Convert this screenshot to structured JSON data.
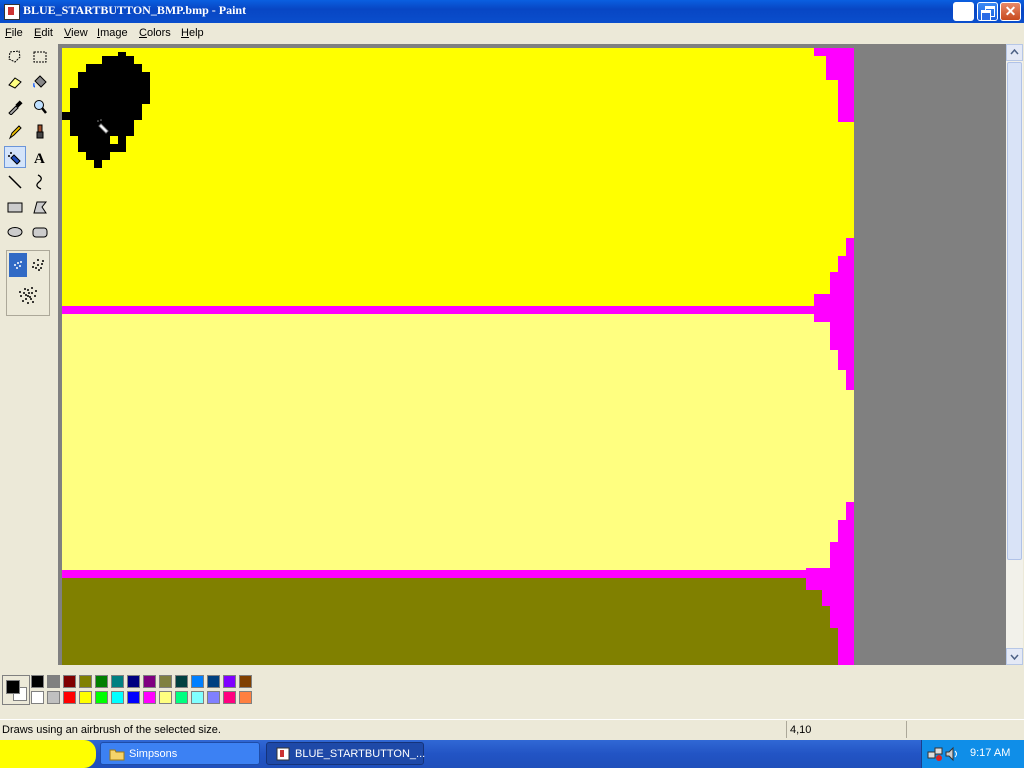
{
  "window": {
    "title": "BLUE_STARTBUTTON_BMP.bmp - Paint"
  },
  "menu": [
    {
      "label": "File",
      "key": "F",
      "rest": "ile"
    },
    {
      "label": "Edit",
      "key": "E",
      "rest": "dit"
    },
    {
      "label": "View",
      "key": "V",
      "rest": "iew"
    },
    {
      "label": "Image",
      "key": "I",
      "rest": "mage"
    },
    {
      "label": "Colors",
      "key": "C",
      "rest": "olors"
    },
    {
      "label": "Help",
      "key": "H",
      "rest": "elp"
    }
  ],
  "tools": [
    "free-form-select",
    "rect-select",
    "eraser",
    "fill-with-color",
    "pick-color",
    "magnifier",
    "pencil",
    "brush",
    "airbrush",
    "text",
    "line",
    "curve",
    "rectangle",
    "polygon",
    "ellipse",
    "rounded-rectangle"
  ],
  "selected_tool": "airbrush",
  "palette": {
    "foreground": "#000000",
    "background": "#ffffff",
    "row1": [
      "#000000",
      "#808080",
      "#800000",
      "#808000",
      "#008000",
      "#008080",
      "#000080",
      "#800080",
      "#808040",
      "#004040",
      "#0080ff",
      "#004080",
      "#8000ff",
      "#804000"
    ],
    "row2": [
      "#ffffff",
      "#c0c0c0",
      "#ff0000",
      "#ffff00",
      "#00ff00",
      "#00ffff",
      "#0000ff",
      "#ff00ff",
      "#ffff80",
      "#00ff80",
      "#80ffff",
      "#8080ff",
      "#ff0080",
      "#ff8040"
    ]
  },
  "canvas": {
    "band_top": "#ffff00",
    "band_middle": "#ffff80",
    "band_bottom": "#808000",
    "separator": "#ff00ff",
    "edge": "#ff00ff",
    "blob": "#000000"
  },
  "status": {
    "text": "Draws using an airbrush of the selected size.",
    "coords": "4,10"
  },
  "taskbar": {
    "items": [
      {
        "label": "Simpsons",
        "icon": "folder-icon"
      },
      {
        "label": "BLUE_STARTBUTTON_...",
        "icon": "paint-icon"
      }
    ],
    "clock": "9:17 AM"
  }
}
